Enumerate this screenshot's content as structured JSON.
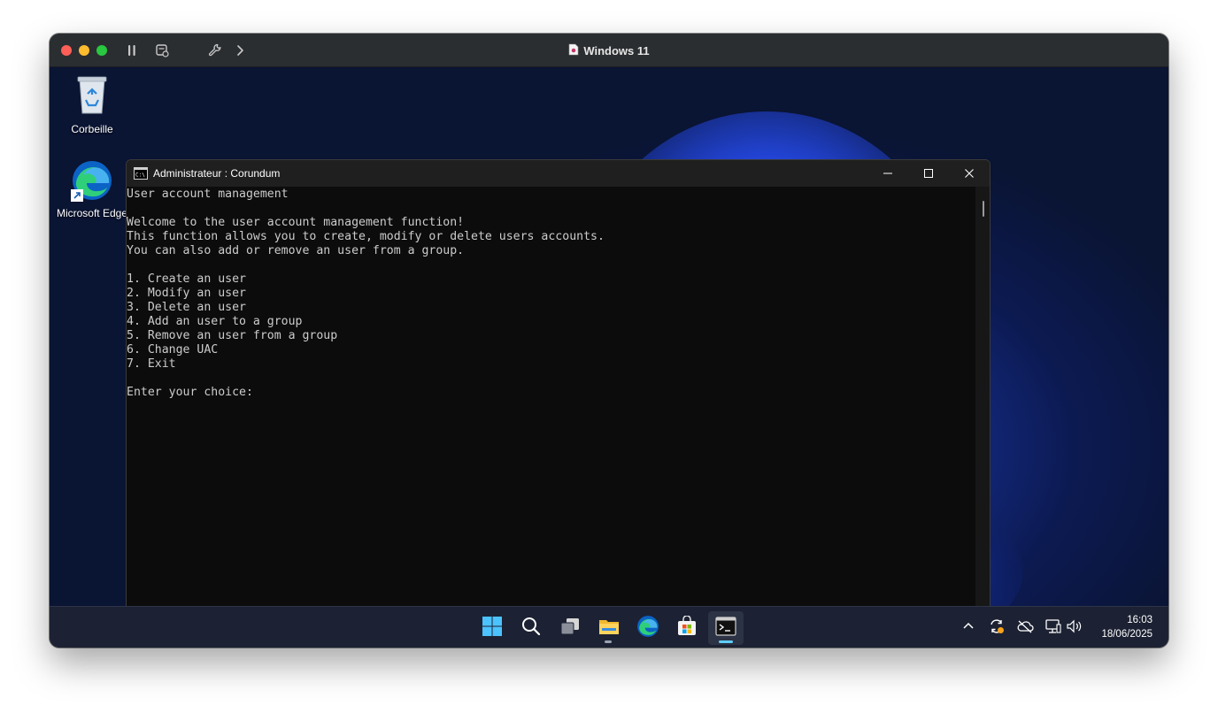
{
  "vm": {
    "title": "Windows 11"
  },
  "desktop": {
    "icons": [
      {
        "label": "Corbeille"
      },
      {
        "label": "Microsoft Edge"
      }
    ]
  },
  "cmd_window": {
    "title": "Administrateur : Corundum",
    "lines": [
      "User account management",
      "",
      "Welcome to the user account management function!",
      "This function allows you to create, modify or delete users accounts.",
      "You can also add or remove an user from a group.",
      "",
      "1. Create an user",
      "2. Modify an user",
      "3. Delete an user",
      "4. Add an user to a group",
      "5. Remove an user from a group",
      "6. Change UAC",
      "7. Exit",
      "",
      "Enter your choice:"
    ]
  },
  "taskbar": {
    "apps": [
      {
        "icon": "windows-start-icon"
      },
      {
        "icon": "search-icon"
      },
      {
        "icon": "task-view-icon"
      },
      {
        "icon": "file-explorer-icon"
      },
      {
        "icon": "edge-icon"
      },
      {
        "icon": "store-icon"
      },
      {
        "icon": "terminal-icon"
      }
    ],
    "tray_icons": [
      "chevron-up-icon",
      "sync-icon",
      "cloud-offline-icon",
      "network-icon",
      "volume-icon"
    ],
    "clock": {
      "time": "16:03",
      "date": "18/06/2025"
    }
  },
  "colors": {
    "terminal_bg": "#0c0c0c",
    "terminal_text": "#cccccc",
    "taskbar_bg": "#1c2233",
    "accent": "#60cdff"
  }
}
